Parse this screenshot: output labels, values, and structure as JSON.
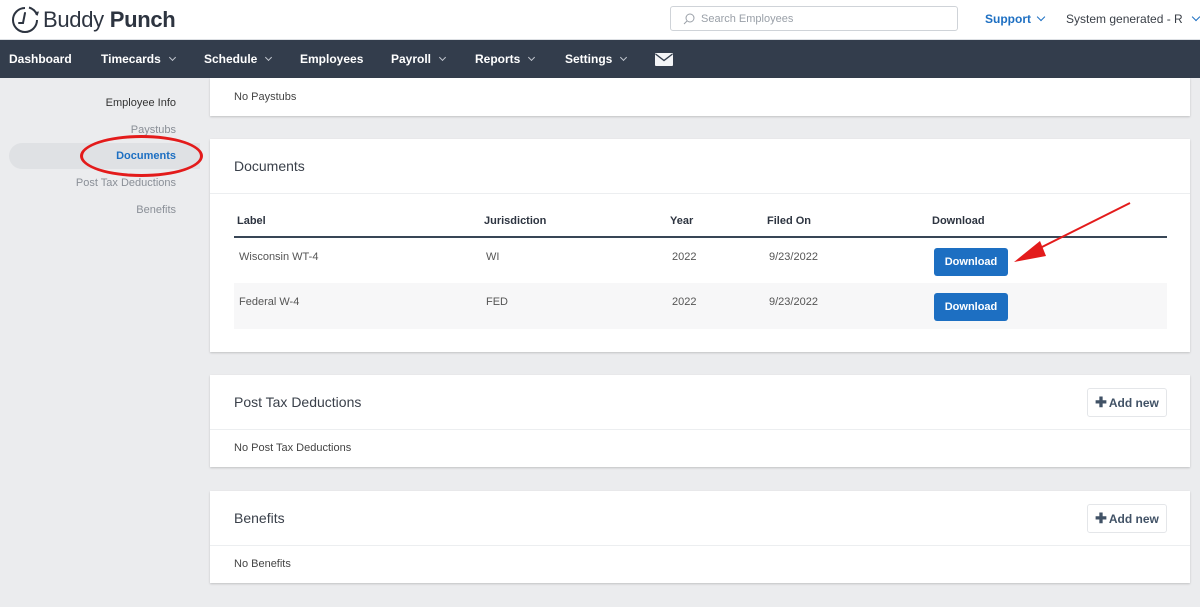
{
  "app": {
    "logo_light": "Buddy",
    "logo_bold": "Punch"
  },
  "header": {
    "search_placeholder": "Search Employees",
    "search_value": "",
    "support_label": "Support",
    "user_label": "System generated - R"
  },
  "nav": {
    "items": [
      {
        "label": "Dashboard",
        "has_dropdown": false
      },
      {
        "label": "Timecards",
        "has_dropdown": true
      },
      {
        "label": "Schedule",
        "has_dropdown": true
      },
      {
        "label": "Employees",
        "has_dropdown": false
      },
      {
        "label": "Payroll",
        "has_dropdown": true,
        "active": true
      },
      {
        "label": "Reports",
        "has_dropdown": true
      },
      {
        "label": "Settings",
        "has_dropdown": true
      }
    ],
    "mail_icon": "envelope-icon"
  },
  "sidebar": {
    "items": [
      {
        "label": "Employee Info"
      },
      {
        "label": "Paystubs"
      },
      {
        "label": "Documents",
        "active": true
      },
      {
        "label": "Post Tax Deductions"
      },
      {
        "label": "Benefits"
      }
    ]
  },
  "paystubs": {
    "empty_text": "No Paystubs"
  },
  "documents": {
    "title": "Documents",
    "columns": [
      "Label",
      "Jurisdiction",
      "Year",
      "Filed On",
      "Download"
    ],
    "rows": [
      {
        "label": "Wisconsin WT-4",
        "jurisdiction": "WI",
        "year": "2022",
        "filed_on": "9/23/2022",
        "action": "Download"
      },
      {
        "label": "Federal W-4",
        "jurisdiction": "FED",
        "year": "2022",
        "filed_on": "9/23/2022",
        "action": "Download"
      }
    ]
  },
  "post_tax": {
    "title": "Post Tax Deductions",
    "add_label": "Add new",
    "empty_text": "No Post Tax Deductions"
  },
  "benefits": {
    "title": "Benefits",
    "add_label": "Add new",
    "empty_text": "No Benefits"
  },
  "colors": {
    "nav_bg": "#333d4c",
    "accent": "#1d6fc2",
    "annotation": "#e31b1b"
  }
}
